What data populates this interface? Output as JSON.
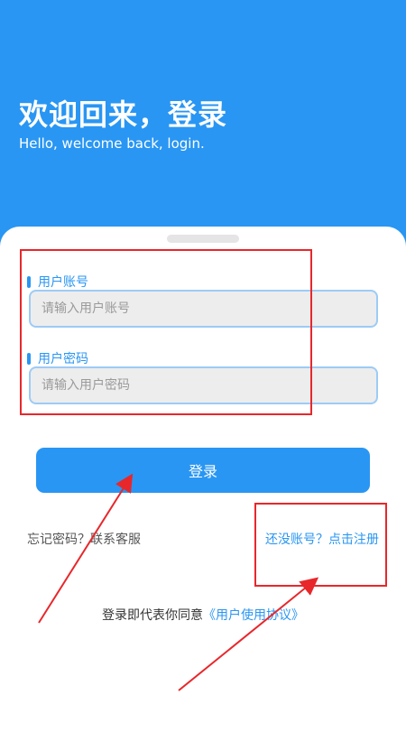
{
  "header": {
    "title": "欢迎回来，登录",
    "subtitle": "Hello, welcome back, login."
  },
  "form": {
    "account_label": "用户账号",
    "account_placeholder": "请输入用户账号",
    "password_label": "用户密码",
    "password_placeholder": "请输入用户密码",
    "login_button": "登录"
  },
  "links": {
    "forgot": "忘记密码？联系客服",
    "register": "还没账号？点击注册"
  },
  "agreement": {
    "prefix": "登录即代表你同意",
    "link": "《用户使用协议》"
  },
  "colors": {
    "primary": "#2996f3",
    "annotation_red": "#e8272b",
    "input_bg": "#ededed",
    "input_border": "#9dcbf6"
  },
  "icons": {
    "field_marker": "vertical-bar"
  }
}
